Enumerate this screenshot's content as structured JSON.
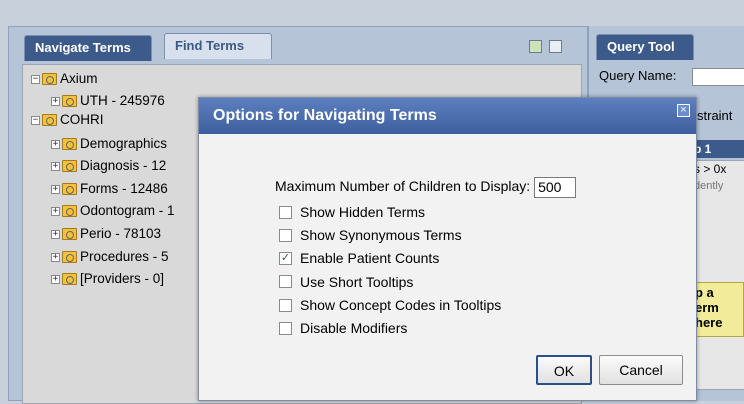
{
  "nav": {
    "tab_navigate": "Navigate Terms",
    "tab_find": "Find Terms",
    "tree": [
      {
        "label": "Axium",
        "expander": "−",
        "level": 0
      },
      {
        "label": "UTH - 245976",
        "expander": "+",
        "level": 1
      },
      {
        "label": "COHRI",
        "expander": "−",
        "level": 0
      },
      {
        "label": "Demographics",
        "expander": "+",
        "level": 1
      },
      {
        "label": "Diagnosis - 12",
        "expander": "+",
        "level": 1
      },
      {
        "label": "Forms - 12486",
        "expander": "+",
        "level": 1
      },
      {
        "label": "Odontogram - 1",
        "expander": "+",
        "level": 1
      },
      {
        "label": "Perio - 78103",
        "expander": "+",
        "level": 1
      },
      {
        "label": "Procedures - 5",
        "expander": "+",
        "level": 1
      },
      {
        "label": "[Providers - 0]",
        "expander": "+",
        "level": 1
      }
    ]
  },
  "query": {
    "tab_label": "Query Tool",
    "query_name_label": "Query Name:",
    "constraint_fragment": "straint",
    "group_label": "p 1",
    "occurs_fragment": "s > 0x",
    "independently_fragment": "dently",
    "drop_lines": [
      "p a",
      "erm",
      " here"
    ]
  },
  "modal": {
    "title": "Options for Navigating Terms",
    "close_glyph": "×",
    "max_children_label": "Maximum Number of Children to Display:",
    "max_children_value": "500",
    "options": [
      {
        "label": "Show Hidden Terms",
        "checked": false
      },
      {
        "label": "Show Synonymous Terms",
        "checked": false
      },
      {
        "label": "Enable Patient Counts",
        "checked": true
      },
      {
        "label": "Use Short Tooltips",
        "checked": false
      },
      {
        "label": "Show Concept Codes in Tooltips",
        "checked": false
      },
      {
        "label": "Disable Modifiers",
        "checked": false
      }
    ],
    "ok_label": "OK",
    "cancel_label": "Cancel"
  }
}
